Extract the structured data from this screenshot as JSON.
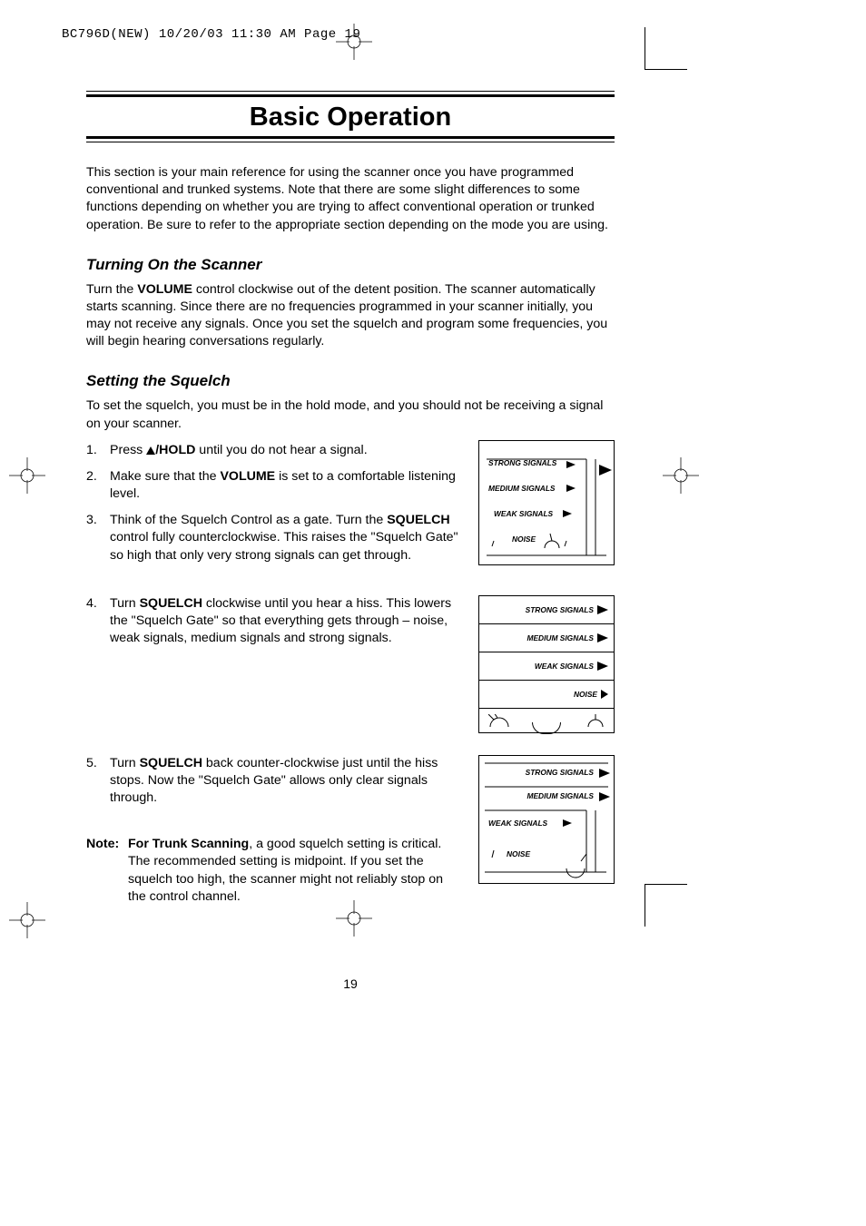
{
  "header_meta": "BC796D(NEW)  10/20/03 11:30 AM  Page 19",
  "title": "Basic Operation",
  "intro": "This section is your main reference for using the scanner once you have programmed conventional and trunked systems. Note that there are some slight differences to some functions depending on whether you are trying to affect conventional operation or trunked operation. Be sure to refer to the appropriate section depending on the mode you are using.",
  "sec1_h": "Turning On the Scanner",
  "sec1_p_pre": "Turn the ",
  "sec1_vol": "VOLUME",
  "sec1_p_post": " control clockwise out of the detent position. The scanner automatically starts scanning. Since there are no frequencies programmed in your scanner initially, you may not receive any signals. Once you set the squelch and program some frequencies, you will begin hearing conversations regularly.",
  "sec2_h": "Setting the Squelch",
  "sec2_p": "To set the squelch, you must be in the hold mode, and you should not be receiving a signal on your scanner.",
  "li1_n": "1.",
  "li1_a": "Press ",
  "li1_hold": "/HOLD",
  "li1_b": " until you do not hear a signal.",
  "li2_n": "2.",
  "li2_a": "Make sure that the ",
  "li2_vol": "VOLUME",
  "li2_b": " is set to a comfortable listening level.",
  "li3_n": "3.",
  "li3_a": "Think of the Squelch Control as a gate. Turn the ",
  "li3_sq": "SQUELCH",
  "li3_b": " control fully counterclockwise. This raises the \"Squelch Gate\" so high that only very strong signals can get through.",
  "li4_n": "4.",
  "li4_a": "Turn ",
  "li4_sq": "SQUELCH",
  "li4_b": " clockwise until you hear a hiss. This lowers the \"Squelch Gate\" so that everything gets through – noise, weak signals, medium signals and strong signals.",
  "li5_n": "5.",
  "li5_a": "Turn ",
  "li5_sq": "SQUELCH",
  "li5_b": " back counter-clockwise just until the hiss stops. Now the \"Squelch Gate\" allows only clear signals through.",
  "note_label": "Note:",
  "note_a": "For Trunk Scanning",
  "note_b": ", a good squelch setting is critical. The recommended setting is midpoint. If you set the squelch too high, the scanner might not reliably stop on the control channel.",
  "fig": {
    "strong": "STRONG SIGNALS",
    "medium": "MEDIUM SIGNALS",
    "weak": "WEAK SIGNALS",
    "noise": "NOISE"
  },
  "page_number": "19"
}
